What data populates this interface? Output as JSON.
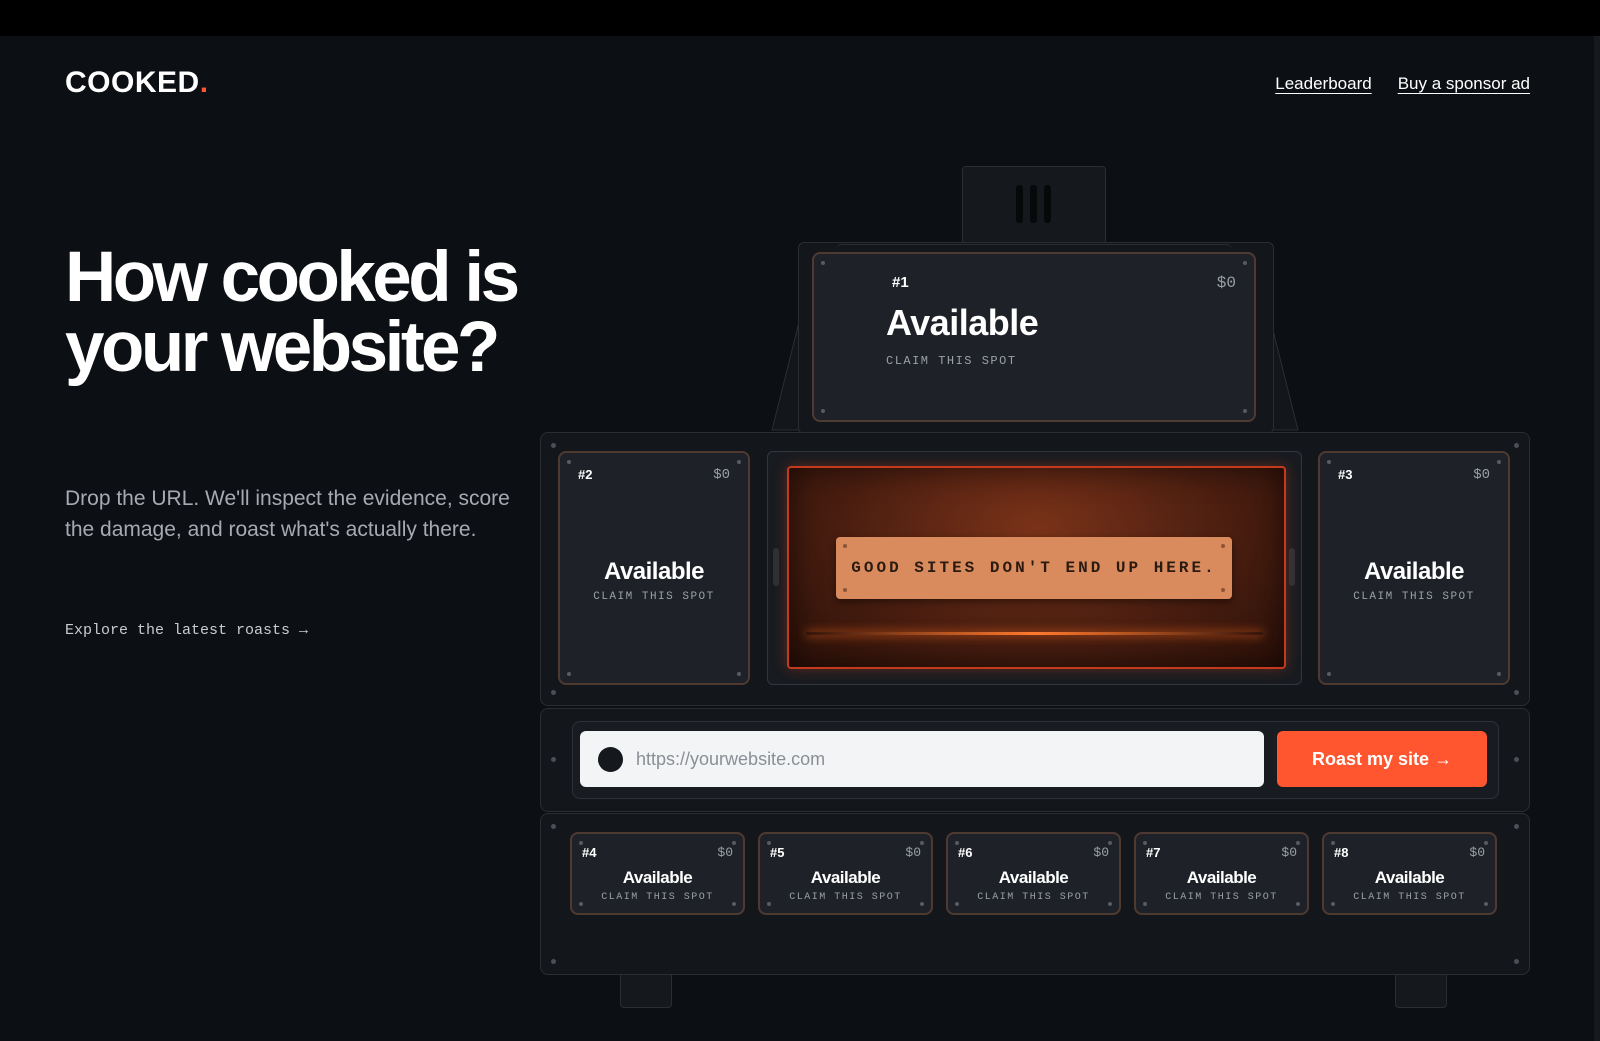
{
  "brand": {
    "name": "COOKED",
    "dot": "."
  },
  "nav": {
    "leaderboard": "Leaderboard",
    "sponsor": "Buy a sponsor ad"
  },
  "hero": {
    "title": "How cooked is your website?",
    "subtitle": "Drop the URL. We'll inspect the evidence, score the damage, and roast what's actually there.",
    "explore": "Explore the latest roasts →"
  },
  "spots": [
    {
      "rank": "#1",
      "price": "$0",
      "title": "Available",
      "cta": "CLAIM THIS SPOT"
    },
    {
      "rank": "#2",
      "price": "$0",
      "title": "Available",
      "cta": "CLAIM THIS SPOT"
    },
    {
      "rank": "#3",
      "price": "$0",
      "title": "Available",
      "cta": "CLAIM THIS SPOT"
    },
    {
      "rank": "#4",
      "price": "$0",
      "title": "Available",
      "cta": "CLAIM THIS SPOT"
    },
    {
      "rank": "#5",
      "price": "$0",
      "title": "Available",
      "cta": "CLAIM THIS SPOT"
    },
    {
      "rank": "#6",
      "price": "$0",
      "title": "Available",
      "cta": "CLAIM THIS SPOT"
    },
    {
      "rank": "#7",
      "price": "$0",
      "title": "Available",
      "cta": "CLAIM THIS SPOT"
    },
    {
      "rank": "#8",
      "price": "$0",
      "title": "Available",
      "cta": "CLAIM THIS SPOT"
    }
  ],
  "oven": {
    "sign": "GOOD SITES DON'T END UP HERE."
  },
  "form": {
    "placeholder": "https://yourwebsite.com",
    "button": "Roast my site →"
  },
  "colors": {
    "accent": "#ff5630",
    "background": "#0c0f13",
    "card": "#1e2228",
    "oven_glow": "#c43a1d",
    "sign": "#d98b5e"
  }
}
